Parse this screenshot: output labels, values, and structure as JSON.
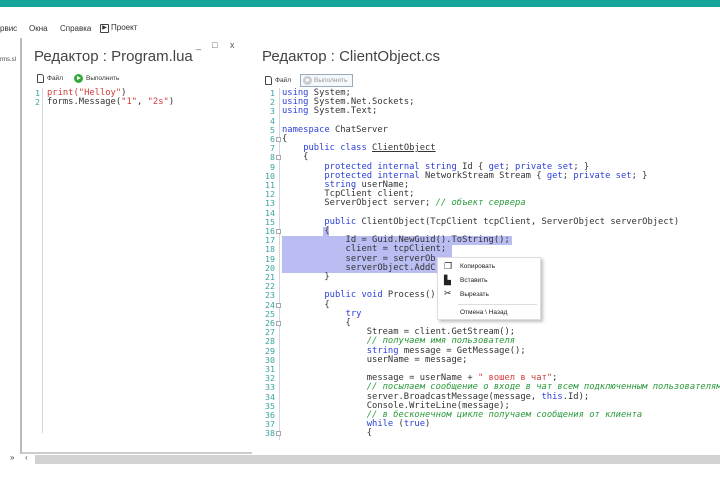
{
  "menu": {
    "items": [
      "рвис",
      "Окна",
      "Справка",
      "Проект"
    ]
  },
  "sidebar": {
    "file_label": "rms.sl"
  },
  "left_editor": {
    "title": "Редактор : Program.lua",
    "file_label": "Файл",
    "run_label": "Выполнить",
    "window_controls": [
      "_",
      "□",
      "x"
    ],
    "lines": [
      [
        [
          "str-fn",
          "print("
        ],
        [
          "str",
          "\"Helloy\""
        ],
        [
          "",
          ")"
        ]
      ],
      [
        [
          "",
          "forms.Message("
        ],
        [
          "str",
          "\"1\""
        ],
        [
          "",
          ", "
        ],
        [
          "str",
          "\"2s\""
        ],
        [
          "",
          ")"
        ]
      ]
    ]
  },
  "right_editor": {
    "title": "Редактор : ClientObject.cs",
    "file_label": "Файл",
    "run_label": "Выполнить",
    "lines": [
      [
        [
          "kw",
          "using"
        ],
        [
          "",
          " System;"
        ]
      ],
      [
        [
          "kw",
          "using"
        ],
        [
          "",
          " System.Net.Sockets;"
        ]
      ],
      [
        [
          "kw",
          "using"
        ],
        [
          "",
          " System.Text;"
        ]
      ],
      [],
      [
        [
          "kw",
          "namespace"
        ],
        [
          "",
          " ChatServer"
        ]
      ],
      [
        [
          "",
          "{"
        ]
      ],
      [
        [
          "",
          "    "
        ],
        [
          "kw",
          "public class"
        ],
        [
          "",
          " "
        ],
        [
          "ul",
          "ClientObject"
        ]
      ],
      [
        [
          "",
          "    {"
        ]
      ],
      [
        [
          "",
          "        "
        ],
        [
          "kw",
          "protected internal string"
        ],
        [
          "",
          " Id { "
        ],
        [
          "kw",
          "get"
        ],
        [
          "",
          "; "
        ],
        [
          "kw",
          "private set"
        ],
        [
          "",
          "; }"
        ]
      ],
      [
        [
          "",
          "        "
        ],
        [
          "kw",
          "protected internal"
        ],
        [
          "",
          " NetworkStream Stream { "
        ],
        [
          "kw",
          "get"
        ],
        [
          "",
          "; "
        ],
        [
          "kw",
          "private set"
        ],
        [
          "",
          "; }"
        ]
      ],
      [
        [
          "",
          "        "
        ],
        [
          "kw",
          "string"
        ],
        [
          "",
          " userName;"
        ]
      ],
      [
        [
          "",
          "        TcpClient client;"
        ]
      ],
      [
        [
          "",
          "        ServerObject server; "
        ],
        [
          "cm",
          "// объект сервера"
        ]
      ],
      [],
      [
        [
          "",
          "        "
        ],
        [
          "kw",
          "public"
        ],
        [
          "",
          " ClientObject(TcpClient tcpClient, ServerObject serverObject)"
        ]
      ],
      [
        [
          "",
          "        {"
        ]
      ],
      [
        [
          "",
          "            Id = Guid.NewGuid().ToString();"
        ]
      ],
      [
        [
          "",
          "            client = tcpClient;"
        ]
      ],
      [
        [
          "",
          "            server = serverOb"
        ]
      ],
      [
        [
          "",
          "            serverObject.AddC"
        ]
      ],
      [
        [
          "",
          "        }"
        ]
      ],
      [],
      [
        [
          "",
          "        "
        ],
        [
          "kw",
          "public void"
        ],
        [
          "",
          " Process()"
        ]
      ],
      [
        [
          "",
          "        {"
        ]
      ],
      [
        [
          "",
          "            "
        ],
        [
          "kw",
          "try"
        ]
      ],
      [
        [
          "",
          "            {"
        ]
      ],
      [
        [
          "",
          "                Stream = client.GetStream();"
        ]
      ],
      [
        [
          "",
          "                "
        ],
        [
          "cm",
          "// получаем имя пользователя"
        ]
      ],
      [
        [
          "",
          "                "
        ],
        [
          "kw",
          "string"
        ],
        [
          "",
          " message = GetMessage();"
        ]
      ],
      [
        [
          "",
          "                userName = message;"
        ]
      ],
      [],
      [
        [
          "",
          "                message = userName + "
        ],
        [
          "str",
          "\" вошел в чат\""
        ],
        [
          "",
          ";"
        ]
      ],
      [
        [
          "",
          "                "
        ],
        [
          "cm",
          "// посылаем сообщение о входе в чат всем подключенным пользователям"
        ]
      ],
      [
        [
          "",
          "                server.BroadcastMessage(message, "
        ],
        [
          "kw",
          "this"
        ],
        [
          "",
          ".Id);"
        ]
      ],
      [
        [
          "",
          "                Console.WriteLine(message);"
        ]
      ],
      [
        [
          "",
          "                "
        ],
        [
          "cm",
          "// в бесконечном цикле получаем сообщения от клиента"
        ]
      ],
      [
        [
          "",
          "                "
        ],
        [
          "kw",
          "while"
        ],
        [
          "",
          " ("
        ],
        [
          "kw",
          "true"
        ],
        [
          "",
          ")"
        ]
      ],
      [
        [
          "",
          "                {"
        ]
      ]
    ],
    "fold_lines": [
      6,
      8,
      16,
      24,
      26,
      38
    ]
  },
  "context_menu": {
    "items": [
      {
        "label": "Копировать",
        "icon": "copy-icon"
      },
      {
        "label": "Вставить",
        "icon": "paste-icon"
      },
      {
        "label": "Вырезать",
        "icon": "cut-icon"
      },
      {
        "label": "Отмена \\ Назад",
        "icon": ""
      }
    ]
  },
  "statusbar": {
    "left_glyphs": [
      "»",
      "‹"
    ]
  },
  "colors": {
    "accent": "#17a49b",
    "selection": "#b9bdf2",
    "keyword": "#2b3fd8",
    "string": "#d23a3a",
    "comment": "#2a9a3a"
  }
}
